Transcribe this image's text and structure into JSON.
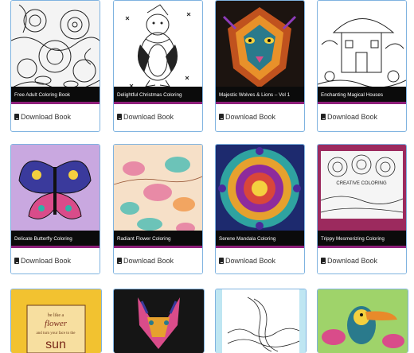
{
  "download_label": "Download Book",
  "books": [
    {
      "title": "Free Adult Coloring Book",
      "theme": "floral-lineart"
    },
    {
      "title": "Delightful Christmas Coloring",
      "theme": "penguin-lineart"
    },
    {
      "title": "Majestic Wolves & Lions – Vol 1",
      "theme": "colorful-lion"
    },
    {
      "title": "Enchanting Magical Houses",
      "theme": "house-lineart"
    },
    {
      "title": "Delicate Butterfly Coloring",
      "theme": "butterfly"
    },
    {
      "title": "Radiant Flower Coloring",
      "theme": "paisley-flowers"
    },
    {
      "title": "Serene Mandala Coloring",
      "theme": "mandala"
    },
    {
      "title": "Trippy Mesmerizing Coloring",
      "theme": "creative-coloring"
    }
  ],
  "cover_texts": {
    "creative": "CREATIVE COLORING",
    "flower_quote_1": "be like a",
    "flower_quote_2": "flower",
    "flower_quote_3": "and turn your face to the",
    "flower_quote_4": "sun"
  }
}
